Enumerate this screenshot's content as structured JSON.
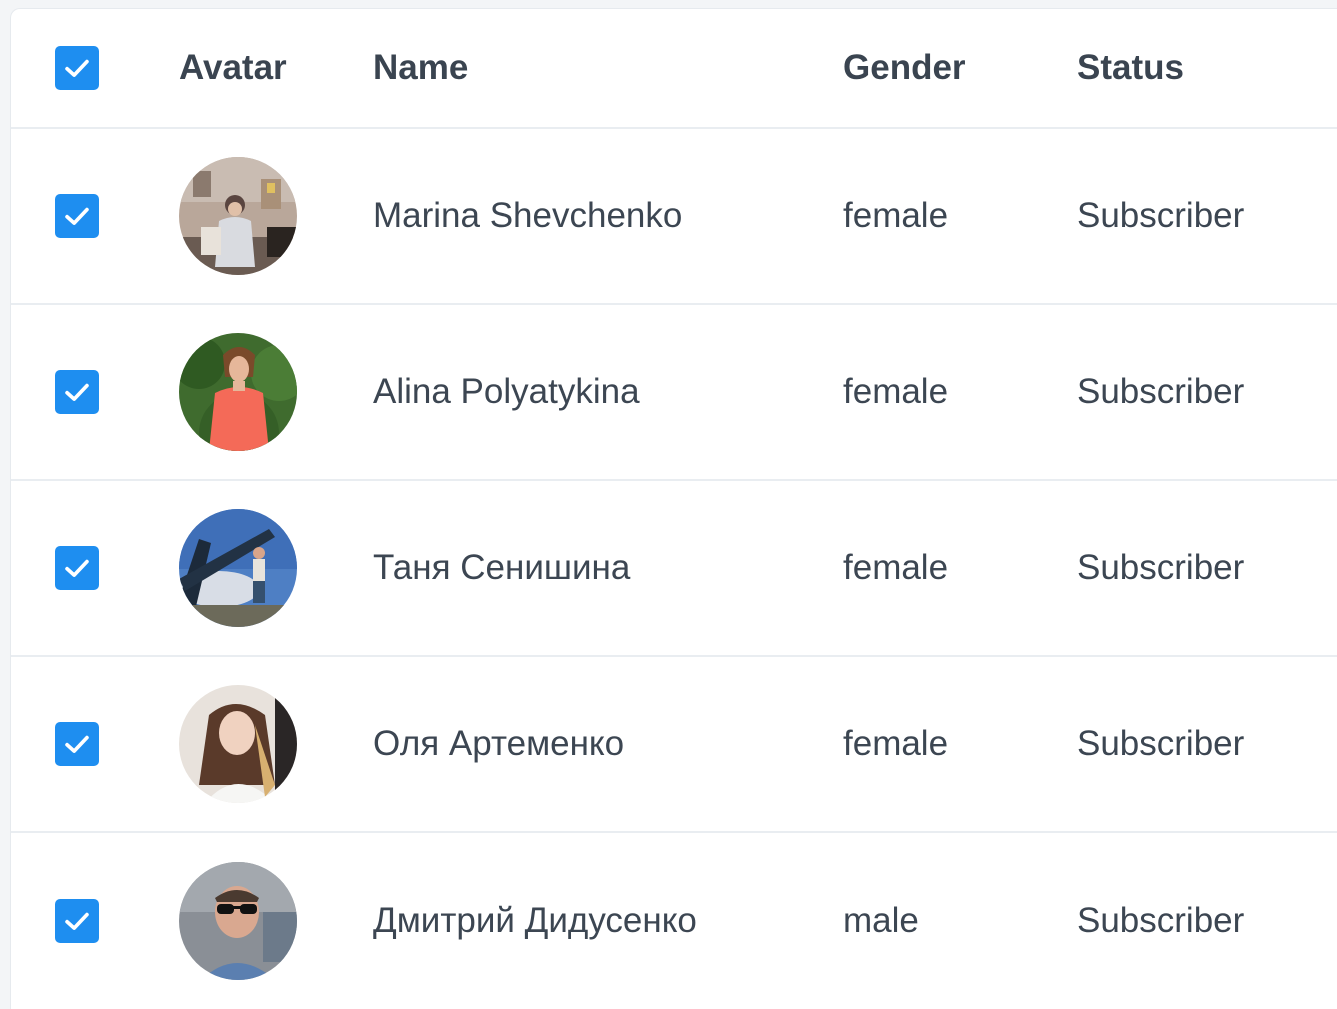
{
  "header": {
    "select_all_checked": true,
    "columns": [
      "Avatar",
      "Name",
      "Gender",
      "Status"
    ]
  },
  "rows": [
    {
      "checked": true,
      "avatar": "photo-woman-indoor",
      "name": "Marina Shevchenko",
      "gender": "female",
      "status": "Subscriber"
    },
    {
      "checked": true,
      "avatar": "photo-woman-coral-top",
      "name": "Alina Polyatykina",
      "gender": "female",
      "status": "Subscriber"
    },
    {
      "checked": true,
      "avatar": "photo-person-sky",
      "name": "Таня Сенишина",
      "gender": "female",
      "status": "Subscriber"
    },
    {
      "checked": true,
      "avatar": "photo-woman-selfie",
      "name": "Оля Артеменко",
      "gender": "female",
      "status": "Subscriber"
    },
    {
      "checked": true,
      "avatar": "photo-man-sunglasses",
      "name": "Дмитрий Дидусенко",
      "gender": "male",
      "status": "Subscriber"
    }
  ],
  "colors": {
    "checkbox": "#1e8ef0",
    "header_text": "#3a4450",
    "cell_text": "#3c4652",
    "divider": "#e9edf1"
  }
}
